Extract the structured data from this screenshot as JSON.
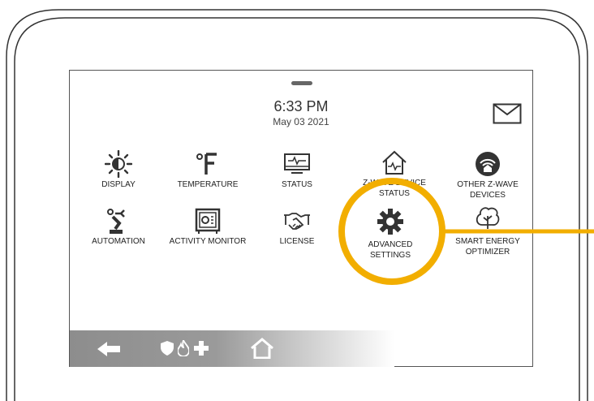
{
  "header": {
    "time": "6:33 PM",
    "date": "May 03 2021"
  },
  "icons": {
    "mail": "envelope-icon",
    "back": "back-arrow-icon",
    "security": "shield-icon",
    "fire": "flame-icon",
    "medical": "cross-icon",
    "home": "home-icon"
  },
  "tiles": [
    {
      "label": "DISPLAY",
      "icon": "brightness-icon"
    },
    {
      "label": "TEMPERATURE",
      "icon": "fahrenheit-icon"
    },
    {
      "label": "STATUS",
      "icon": "monitor-pulse-icon"
    },
    {
      "label": "Z-WAVE DEVICE STATUS",
      "icon": "house-pulse-icon"
    },
    {
      "label": "OTHER Z-WAVE DEVICES",
      "icon": "wireless-home-icon"
    },
    {
      "label": "AUTOMATION",
      "icon": "robot-arm-icon"
    },
    {
      "label": "ACTIVITY MONITOR",
      "icon": "safe-icon"
    },
    {
      "label": "LICENSE",
      "icon": "handshake-icon"
    },
    {
      "label": "ADVANCED SETTINGS",
      "icon": "gear-icon"
    },
    {
      "label": "SMART ENERGY OPTIMIZER",
      "icon": "tree-icon"
    }
  ],
  "highlight": {
    "target": "ADVANCED SETTINGS",
    "color": "#F2AE00"
  },
  "colors": {
    "icon": "#333333",
    "highlight": "#F2AE00",
    "frame": "#333333"
  }
}
